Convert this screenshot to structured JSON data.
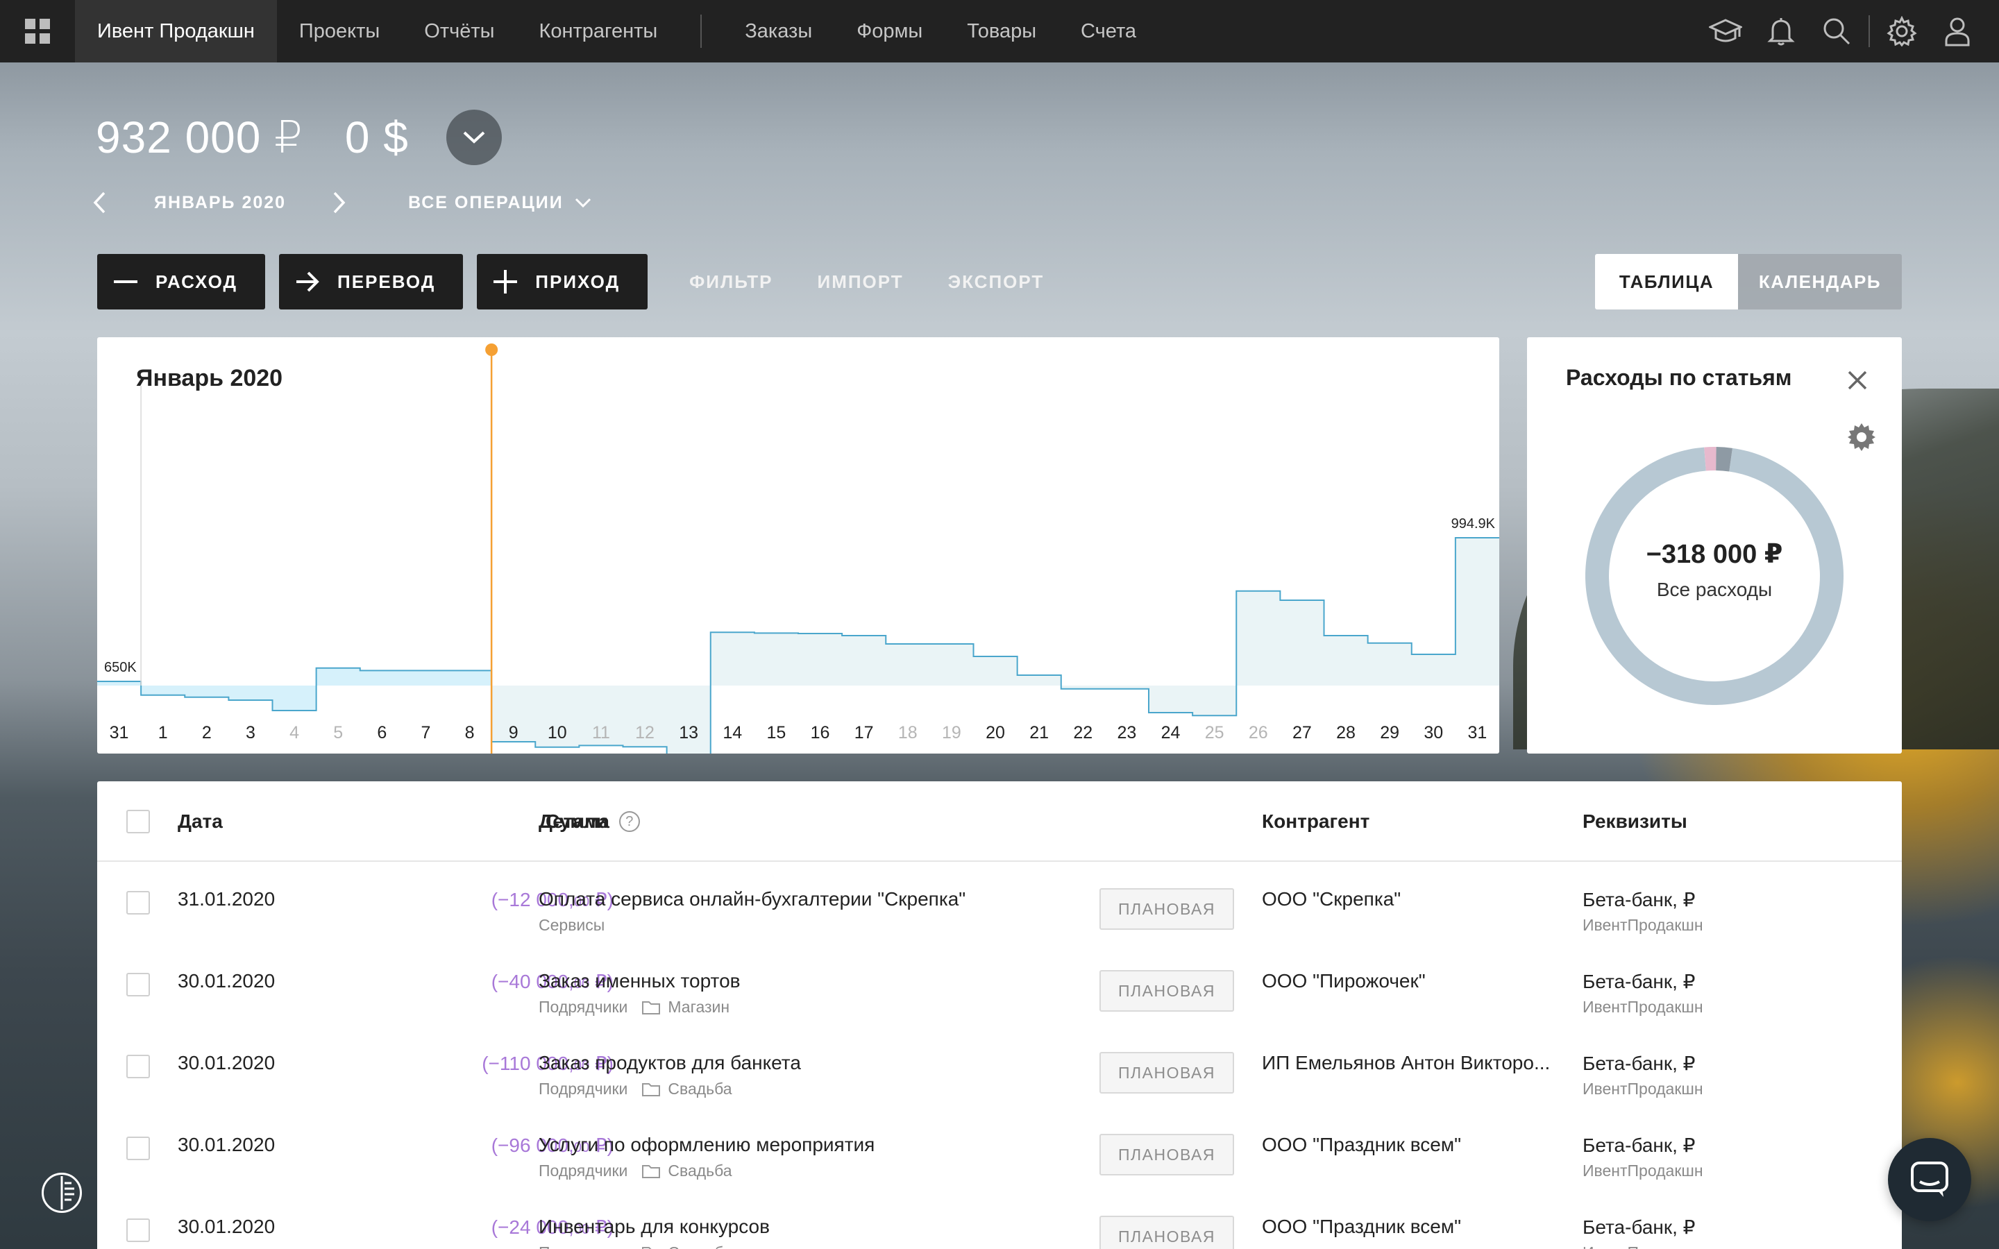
{
  "nav": {
    "company": "Ивент Продакшн",
    "items": [
      "Проекты",
      "Отчёты",
      "Контрагенты"
    ],
    "items2": [
      "Заказы",
      "Формы",
      "Товары",
      "Счета"
    ]
  },
  "balance": {
    "rub": "932 000 ₽",
    "usd": "0 $"
  },
  "period": {
    "month": "ЯНВАРЬ 2020",
    "operations": "ВСЕ ОПЕРАЦИИ"
  },
  "actions": {
    "expense": "РАСХОД",
    "transfer": "ПЕРЕВОД",
    "income": "ПРИХОД",
    "filter": "ФИЛЬТР",
    "import": "ИМПОРТ",
    "export": "ЭКСПОРТ"
  },
  "view": {
    "table": "ТАБЛИЦА",
    "calendar": "КАЛЕНДАРЬ"
  },
  "chart_data": {
    "type": "area",
    "title": "Январь 2020",
    "x": [
      "31",
      "1",
      "2",
      "3",
      "4",
      "5",
      "6",
      "7",
      "8",
      "9",
      "10",
      "11",
      "12",
      "13",
      "14",
      "15",
      "16",
      "17",
      "18",
      "19",
      "20",
      "21",
      "22",
      "23",
      "24",
      "25",
      "26",
      "27",
      "28",
      "29",
      "30",
      "31"
    ],
    "weekend_days": [
      "4",
      "5",
      "11",
      "12",
      "18",
      "19",
      "25",
      "26"
    ],
    "values": [
      650,
      617,
      612,
      605,
      580,
      682,
      676,
      676,
      676,
      505,
      492,
      496,
      493,
      467,
      768,
      766,
      765,
      760,
      740,
      740,
      710,
      665,
      632,
      632,
      575,
      568,
      867,
      845,
      760,
      742,
      715,
      994.9
    ],
    "annotations": {
      "start": "650K",
      "end": "994.9K"
    },
    "current_day": "8",
    "colors": {
      "past_fill": "#d6f1fb",
      "future_fill": "#eaf4f6",
      "line": "#4aa6cc",
      "today": "#f5a033"
    }
  },
  "donut": {
    "title": "Расходы по статьям",
    "amount": "−318 000 ₽",
    "label": "Все расходы",
    "segments": [
      {
        "share": 0.965,
        "color": "#b7c8d3"
      },
      {
        "share": 0.02,
        "color": "#8e9aa4"
      },
      {
        "share": 0.015,
        "color": "#e7b9cd"
      }
    ]
  },
  "table": {
    "headers": {
      "date": "Дата",
      "sum": "Сумма",
      "details": "Детали",
      "contractor": "Контрагент",
      "requisites": "Реквизиты"
    },
    "rows": [
      {
        "date": "31.01.2020",
        "sum_main": "(−12 000,",
        "sum_cents": "00",
        "sum_tail": " ₽)",
        "title": "Оплата сервиса онлайн-бухгалтерии \"Скрепка\"",
        "category": "Сервисы",
        "project": "",
        "status": "ПЛАНОВАЯ",
        "contractor": "ООО \"Скрепка\"",
        "bank": "Бета-банк, ₽",
        "company": "ИвентПродакшн"
      },
      {
        "date": "30.01.2020",
        "sum_main": "(−40 000,",
        "sum_cents": "00",
        "sum_tail": " ₽)",
        "title": "Заказ именных тортов",
        "category": "Подрядчики",
        "project": "Магазин",
        "status": "ПЛАНОВАЯ",
        "contractor": "ООО \"Пирожочек\"",
        "bank": "Бета-банк, ₽",
        "company": "ИвентПродакшн"
      },
      {
        "date": "30.01.2020",
        "sum_main": "(−110 000,",
        "sum_cents": "00",
        "sum_tail": " ₽)",
        "title": "Заказ продуктов для банкета",
        "category": "Подрядчики",
        "project": "Свадьба",
        "status": "ПЛАНОВАЯ",
        "contractor": "ИП Емельянов Антон Викторо...",
        "bank": "Бета-банк, ₽",
        "company": "ИвентПродакшн"
      },
      {
        "date": "30.01.2020",
        "sum_main": "(−96 000,",
        "sum_cents": "00",
        "sum_tail": " ₽)",
        "title": "Услуги по оформлению мероприятия",
        "category": "Подрядчики",
        "project": "Свадьба",
        "status": "ПЛАНОВАЯ",
        "contractor": "ООО \"Праздник всем\"",
        "bank": "Бета-банк, ₽",
        "company": "ИвентПродакшн"
      },
      {
        "date": "30.01.2020",
        "sum_main": "(−24 000,",
        "sum_cents": "00",
        "sum_tail": " ₽)",
        "title": "Инвентарь для конкурсов",
        "category": "Подрядчики",
        "project": "Свадьба",
        "status": "ПЛАНОВАЯ",
        "contractor": "ООО \"Праздник всем\"",
        "bank": "Бета-банк, ₽",
        "company": "ИвентПродакшн"
      }
    ]
  }
}
